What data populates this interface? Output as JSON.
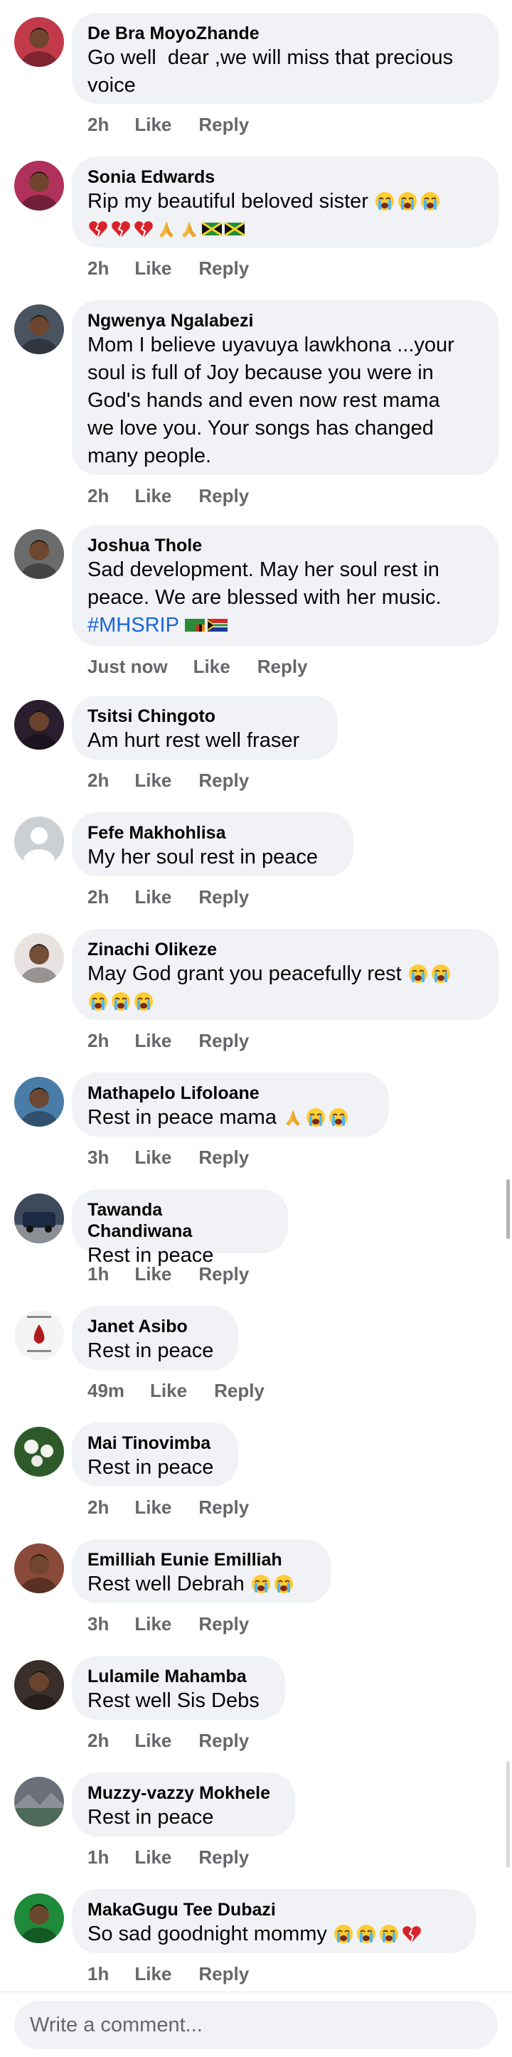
{
  "comments": [
    {
      "author": "De Bra MoyoZhande",
      "text": "Go well  dear ,we will miss that precious\nvoice",
      "time": "2h",
      "like": "Like",
      "reply": "Reply",
      "avatar": "woman-portrait-avatar",
      "avatar_color": "#c23a4a"
    },
    {
      "author": "Sonia Edwards",
      "text": "Rip my beautiful beloved sister",
      "emojis_line1": [
        "loudly-crying-face",
        "loudly-crying-face",
        "loudly-crying-face"
      ],
      "emojis_line2": [
        "broken-heart",
        "broken-heart",
        "broken-heart",
        "folded-hands",
        "folded-hands",
        "jamaica-flag",
        "jamaica-flag"
      ],
      "time": "2h",
      "like": "Like",
      "reply": "Reply",
      "avatar": "woman-portrait-avatar",
      "avatar_color": "#b0315a"
    },
    {
      "author": "Ngwenya Ngalabezi",
      "text": "Mom I believe uyavuya lawkhona ...your\nsoul is full of Joy because you were in\nGod's hands and even now rest mama\nwe love you. Your songs has changed\nmany people.",
      "time": "2h",
      "like": "Like",
      "reply": "Reply",
      "avatar": "man-outdoor-avatar",
      "avatar_color": "#4a5360"
    },
    {
      "author": "Joshua Thole",
      "text": "Sad development. May her soul rest in\npeace. We are blessed with her music.",
      "hashtag": "#MHSRIP",
      "emojis_after_hashtag": [
        "zambia-flag",
        "south-africa-flag"
      ],
      "time": "Just now",
      "like": "Like",
      "reply": "Reply",
      "avatar": "man-bw-avatar",
      "avatar_color": "#6b6b6b"
    },
    {
      "author": "Tsitsi Chingoto",
      "text": "Am hurt rest well fraser",
      "time": "2h",
      "like": "Like",
      "reply": "Reply",
      "avatar": "selfie-avatar",
      "avatar_color": "#2a1e2e"
    },
    {
      "author": "Fefe Makhohlisa",
      "text": "My her soul rest in peace",
      "time": "2h",
      "like": "Like",
      "reply": "Reply",
      "avatar": "default-profile-avatar",
      "avatar_color": "#ccd0d5"
    },
    {
      "author": "Zinachi Olikeze",
      "text": "May God grant you peacefully rest",
      "emojis_line1": [
        "loudly-crying-face",
        "loudly-crying-face"
      ],
      "emojis_line2": [
        "loudly-crying-face",
        "loudly-crying-face",
        "loudly-crying-face"
      ],
      "time": "2h",
      "like": "Like",
      "reply": "Reply",
      "avatar": "woman-light-avatar",
      "avatar_color": "#e8e2e0"
    },
    {
      "author": "Mathapelo Lifoloane",
      "text": "Rest in peace mama",
      "emojis_line1": [
        "folded-hands",
        "loudly-crying-face",
        "loudly-crying-face"
      ],
      "time": "3h",
      "like": "Like",
      "reply": "Reply",
      "avatar": "standing-person-avatar",
      "avatar_color": "#4a7ca8"
    },
    {
      "author": "Tawanda Chandiwana",
      "text": "Rest in peace",
      "time": "1h",
      "like": "Like",
      "reply": "Reply",
      "avatar": "car-avatar",
      "avatar_color": "#3d4a5c"
    },
    {
      "author": "Janet Asibo",
      "text": "Rest in peace",
      "time": "49m",
      "like": "Like",
      "reply": "Reply",
      "avatar": "blood-drop-avatar",
      "avatar_color": "#f4f4f4"
    },
    {
      "author": "Mai Tinovimba",
      "text": "Rest in peace",
      "time": "2h",
      "like": "Like",
      "reply": "Reply",
      "avatar": "white-flowers-avatar",
      "avatar_color": "#2e5a2a"
    },
    {
      "author": "Emilliah Eunie Emilliah",
      "text": "Rest well Debrah",
      "emojis_line1": [
        "loudly-crying-face",
        "loudly-crying-face"
      ],
      "time": "3h",
      "like": "Like",
      "reply": "Reply",
      "avatar": "woman-warm-avatar",
      "avatar_color": "#8a4a3a"
    },
    {
      "author": "Lulamile Mahamba",
      "text": "Rest well Sis Debs",
      "time": "2h",
      "like": "Like",
      "reply": "Reply",
      "avatar": "group-photo-avatar",
      "avatar_color": "#3a2f2a"
    },
    {
      "author": "Muzzy-vazzy Mokhele",
      "text": "Rest in peace",
      "time": "1h",
      "like": "Like",
      "reply": "Reply",
      "avatar": "landscape-avatar",
      "avatar_color": "#6a6f7a"
    },
    {
      "author": "MakaGugu Tee Dubazi",
      "text": "So sad goodnight mommy",
      "emojis_line1": [
        "loudly-crying-face",
        "loudly-crying-face",
        "loudly-crying-face",
        "broken-heart"
      ],
      "time": "1h",
      "like": "Like",
      "reply": "Reply",
      "avatar": "woman-green-avatar",
      "avatar_color": "#1f8a3a"
    }
  ],
  "composer": {
    "placeholder": "Write a comment..."
  },
  "colors": {
    "bubble": "#f0f2f5",
    "meta": "#65676b",
    "hashtag": "#1a66d9"
  }
}
